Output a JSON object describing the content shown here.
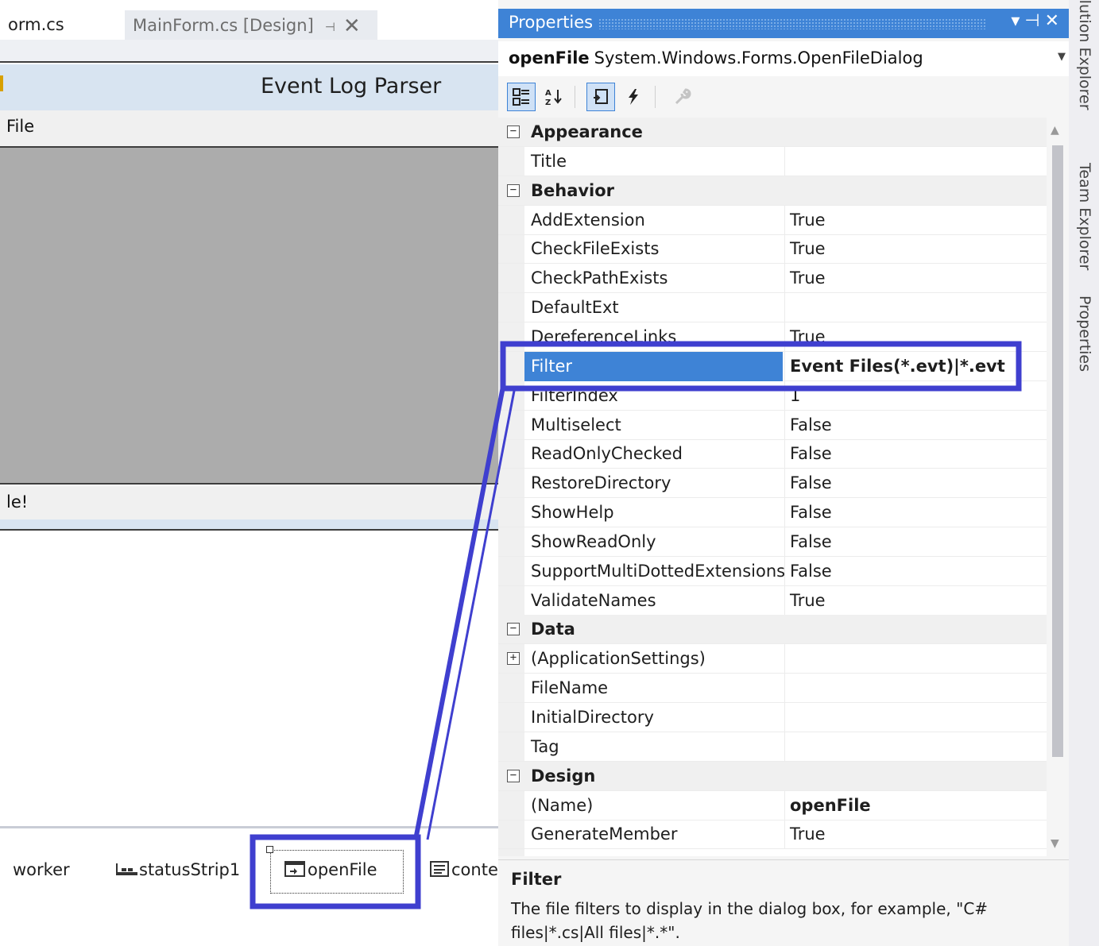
{
  "doc_tabs": [
    {
      "label": "orm.cs"
    },
    {
      "label": "MainForm.cs [Design]",
      "pin": "⊣",
      "close": "✕"
    }
  ],
  "form": {
    "title": "Event Log Parser",
    "menu_item": "File",
    "status_text": "le!"
  },
  "tray": {
    "items": [
      "worker",
      "statusStrip1",
      "openFile",
      "conte"
    ]
  },
  "properties": {
    "title": "Properties",
    "object_name": "openFile",
    "object_type": "System.Windows.Forms.OpenFileDialog",
    "toolbar": {
      "categorized": "categorized-icon",
      "alphabetical": "alphabetical-icon",
      "properties": "properties-icon",
      "events": "events-icon",
      "property_pages": "wrench-icon"
    },
    "rows": [
      {
        "type": "cat",
        "name": "Appearance",
        "expander": "⊟"
      },
      {
        "name": "Title",
        "value": ""
      },
      {
        "type": "cat",
        "name": "Behavior",
        "expander": "⊟"
      },
      {
        "name": "AddExtension",
        "value": "True"
      },
      {
        "name": "CheckFileExists",
        "value": "True"
      },
      {
        "name": "CheckPathExists",
        "value": "True"
      },
      {
        "name": "DefaultExt",
        "value": ""
      },
      {
        "name": "DereferenceLinks",
        "value": "True"
      },
      {
        "name": "Filter",
        "value": "Event Files(*.evt)|*.evt",
        "selected": true
      },
      {
        "name": "FilterIndex",
        "value": "1"
      },
      {
        "name": "Multiselect",
        "value": "False"
      },
      {
        "name": "ReadOnlyChecked",
        "value": "False"
      },
      {
        "name": "RestoreDirectory",
        "value": "False"
      },
      {
        "name": "ShowHelp",
        "value": "False"
      },
      {
        "name": "ShowReadOnly",
        "value": "False"
      },
      {
        "name": "SupportMultiDottedExtensions",
        "value": "False"
      },
      {
        "name": "ValidateNames",
        "value": "True"
      },
      {
        "type": "cat",
        "name": "Data",
        "expander": "⊟"
      },
      {
        "name": "(ApplicationSettings)",
        "value": "",
        "expander": "⊞"
      },
      {
        "name": "FileName",
        "value": ""
      },
      {
        "name": "InitialDirectory",
        "value": ""
      },
      {
        "name": "Tag",
        "value": ""
      },
      {
        "type": "cat",
        "name": "Design",
        "expander": "⊟"
      },
      {
        "name": "(Name)",
        "value": "openFile",
        "bold": true
      },
      {
        "name": "GenerateMember",
        "value": "True"
      }
    ],
    "description": {
      "heading": "Filter",
      "text": "The file filters to display in the dialog box, for example, \"C# files|*.cs|All files|*.*\"."
    }
  },
  "side_tabs": [
    "Solution Explorer",
    "Team Explorer",
    "Properties"
  ],
  "colors": {
    "accent": "#3e83d6",
    "annotation": "#3f3fcf"
  }
}
